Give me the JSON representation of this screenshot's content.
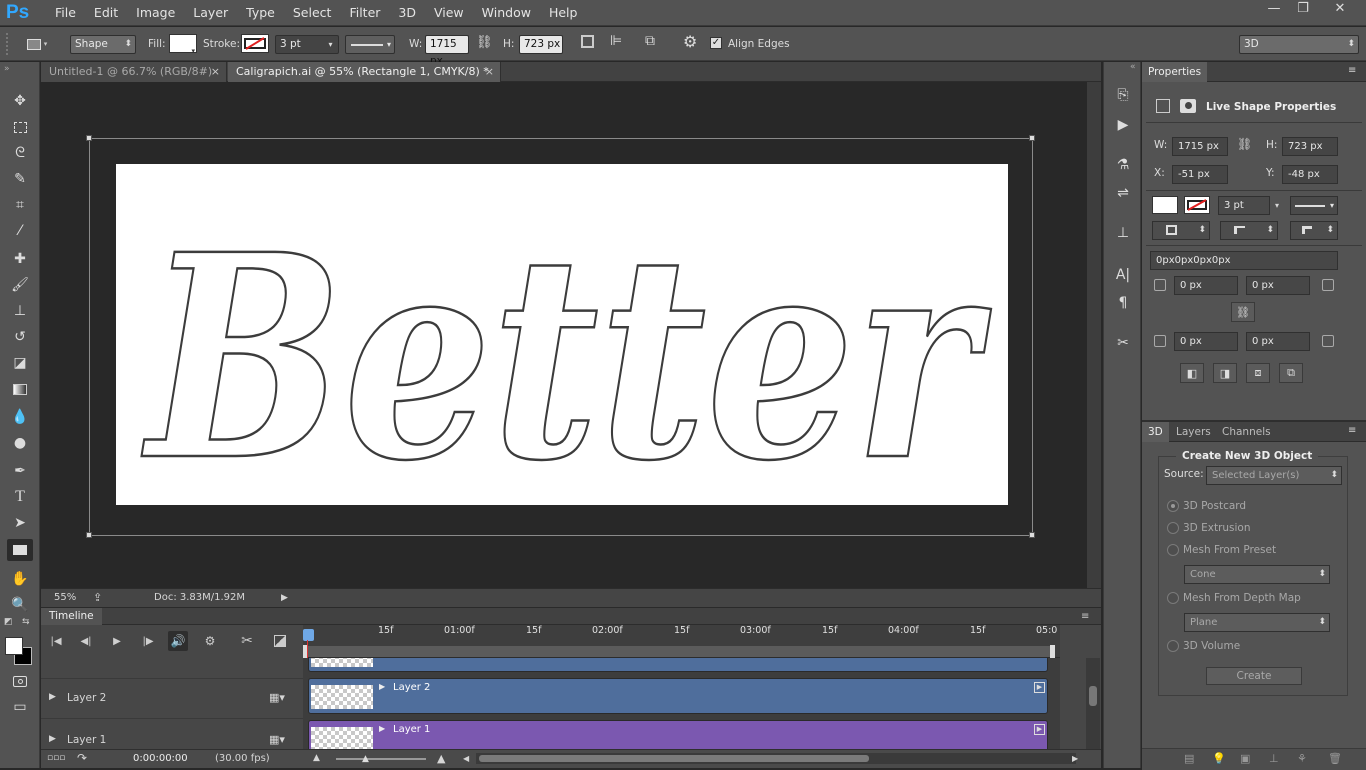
{
  "app": {
    "logo": "Ps"
  },
  "menu": [
    "File",
    "Edit",
    "Image",
    "Layer",
    "Type",
    "Select",
    "Filter",
    "3D",
    "View",
    "Window",
    "Help"
  ],
  "window_controls": {
    "minimize": "—",
    "restore": "❐",
    "close": "✕"
  },
  "options_bar": {
    "mode": "Shape",
    "fill_label": "Fill:",
    "stroke_label": "Stroke:",
    "stroke_width": "3 pt",
    "width_label": "W:",
    "width_value": "1715 px",
    "height_label": "H:",
    "height_value": "723 px",
    "align_edges_label": "Align Edges",
    "align_edges_checked": true,
    "workspace": "3D"
  },
  "doc_tabs": [
    {
      "title": "Untitled-1 @ 66.7% (RGB/8#)",
      "close": "×"
    },
    {
      "title": "Caligrapich.ai @ 55% (Rectangle 1, CMYK/8) *",
      "close": "×"
    }
  ],
  "canvas": {
    "text": "Better"
  },
  "status": {
    "zoom": "55%",
    "doc": "Doc: 3.83M/1.92M"
  },
  "timeline": {
    "title": "Timeline",
    "ruler": [
      "15f",
      "01:00f",
      "15f",
      "02:00f",
      "15f",
      "03:00f",
      "15f",
      "04:00f",
      "15f",
      "05:0"
    ],
    "tracks": [
      {
        "name": "Layer 2",
        "clip": "Layer 2",
        "color": "#4f6e9c"
      },
      {
        "name": "Layer 1",
        "clip": "Layer 1",
        "color": "#7b58b0"
      }
    ],
    "timecode": "0:00:00:00",
    "fps": "(30.00 fps)"
  },
  "properties": {
    "tab": "Properties",
    "header": "Live Shape Properties",
    "w_label": "W:",
    "w": "1715 px",
    "h_label": "H:",
    "h": "723 px",
    "x_label": "X:",
    "x": "-51 px",
    "y_label": "Y:",
    "y": "-48 px",
    "stroke": "3 pt",
    "corners": "0px0px0px0px",
    "corner_tl": "0 px",
    "corner_tr": "0 px",
    "corner_bl": "0 px",
    "corner_br": "0 px"
  },
  "panel3d": {
    "tabs": [
      "3D",
      "Layers",
      "Channels"
    ],
    "title": "Create New 3D Object",
    "source_label": "Source:",
    "source_value": "Selected Layer(s)",
    "options": [
      "3D Postcard",
      "3D Extrusion",
      "Mesh From Preset",
      "Mesh From Depth Map",
      "3D Volume"
    ],
    "selected": "3D Postcard",
    "preset_value": "Cone",
    "depth_value": "Plane",
    "create_label": "Create"
  },
  "colors": {
    "accent": "#31a8ff",
    "panel": "#535353",
    "clip_blue": "#4f6e9c",
    "clip_purple": "#7b58b0"
  }
}
